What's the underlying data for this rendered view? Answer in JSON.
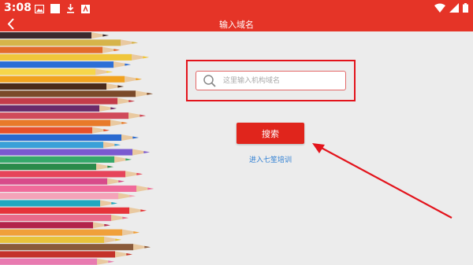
{
  "status_bar": {
    "time": "3:08",
    "left_icons": [
      "image-icon",
      "square-notification-icon",
      "download-icon",
      "app-notification-icon"
    ],
    "right_icons": [
      "wifi-icon",
      "signal-icon",
      "battery-icon"
    ]
  },
  "app_bar": {
    "title": "输入域名",
    "back_icon": "chevron-left-icon"
  },
  "search": {
    "placeholder": "这里输入机构域名",
    "value": "",
    "icon": "search-icon"
  },
  "search_button_label": "搜索",
  "enter_link": "进入七笙培训",
  "colors": {
    "brand_red": "#e53427",
    "button_red": "#e0251c",
    "highlight_red": "#e3141c",
    "link_blue": "#2f7fd3",
    "background": "#ececec"
  }
}
